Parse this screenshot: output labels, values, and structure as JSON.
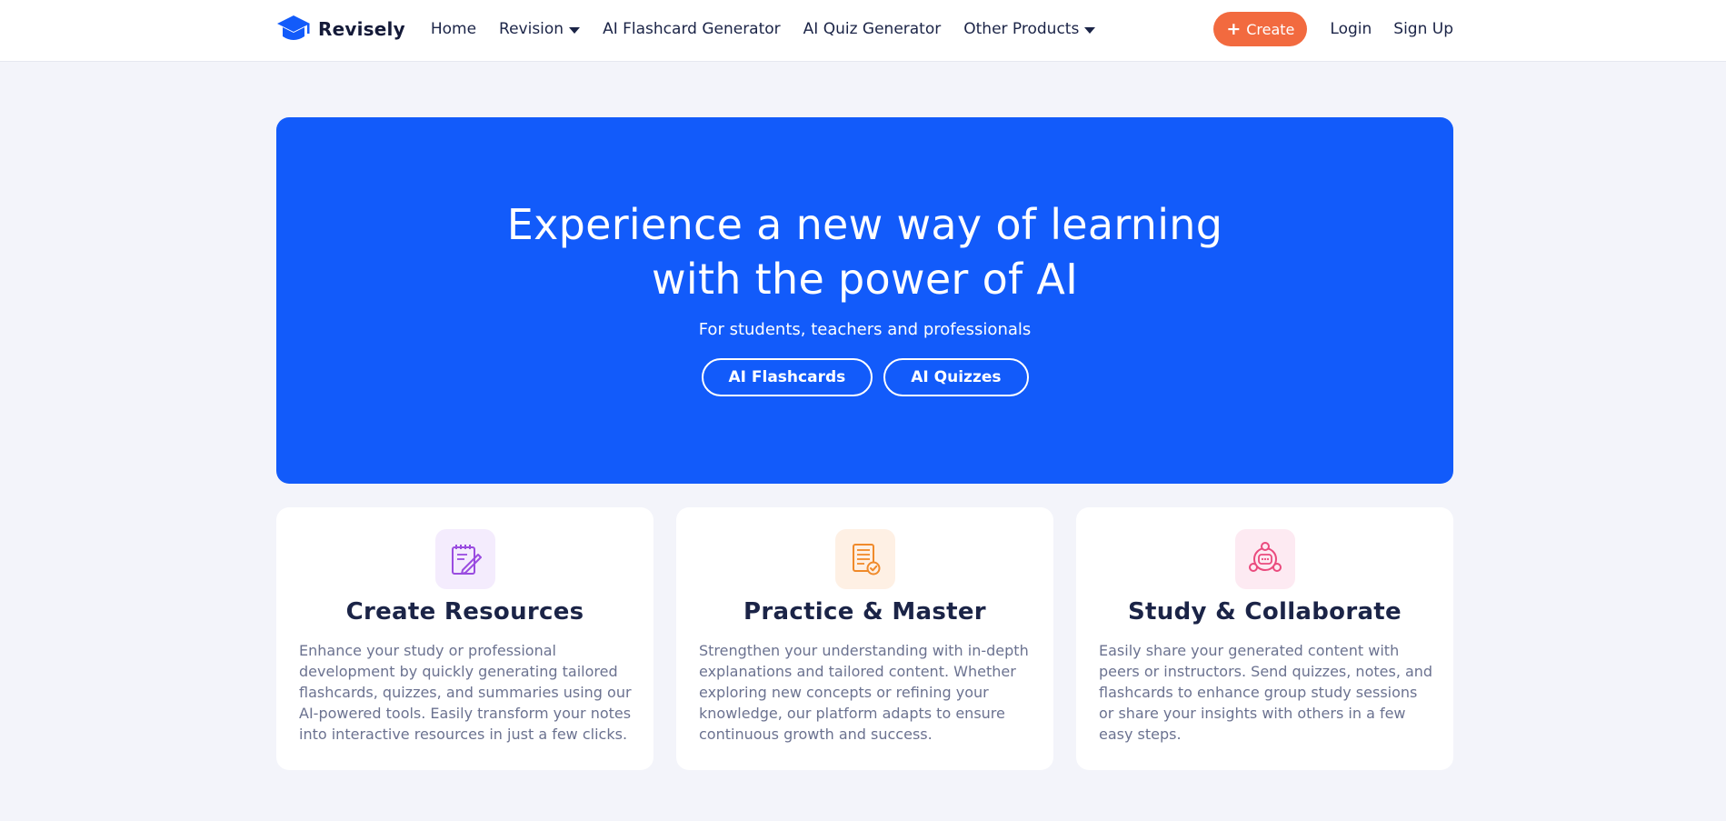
{
  "header": {
    "brand": "Revisely",
    "nav": [
      {
        "label": "Home"
      },
      {
        "label": "Revision"
      },
      {
        "label": "AI Flashcard Generator"
      },
      {
        "label": "AI Quiz Generator"
      },
      {
        "label": "Other Products"
      }
    ],
    "create_label": "Create",
    "login_label": "Login",
    "signup_label": "Sign Up"
  },
  "hero": {
    "title_line1": "Experience a new way of learning",
    "title_line2": "with the power of AI",
    "subtitle": "For students, teachers and professionals",
    "buttons": [
      "AI Flashcards",
      "AI Quizzes"
    ]
  },
  "cards": [
    {
      "title": "Create Resources",
      "text": "Enhance your study or professional development by quickly generating tailored flashcards, quizzes, and summaries using our AI-powered tools. Easily transform your notes into interactive resources in just a few clicks.",
      "icon": "notepad-pencil-icon"
    },
    {
      "title": "Practice & Master",
      "text": "Strengthen your understanding with in-depth explanations and tailored content. Whether exploring new concepts or refining your knowledge, our platform adapts to ensure continuous growth and success.",
      "icon": "document-check-icon"
    },
    {
      "title": "Study & Collaborate",
      "text": "Easily share your generated content with peers or instructors. Send quizzes, notes, and flashcards to enhance group study sessions or share your insights with others in a few easy steps.",
      "icon": "group-chat-icon"
    }
  ],
  "colors": {
    "primary": "#125bfa",
    "accent": "#f26a3f",
    "background": "#f3f4fa"
  }
}
